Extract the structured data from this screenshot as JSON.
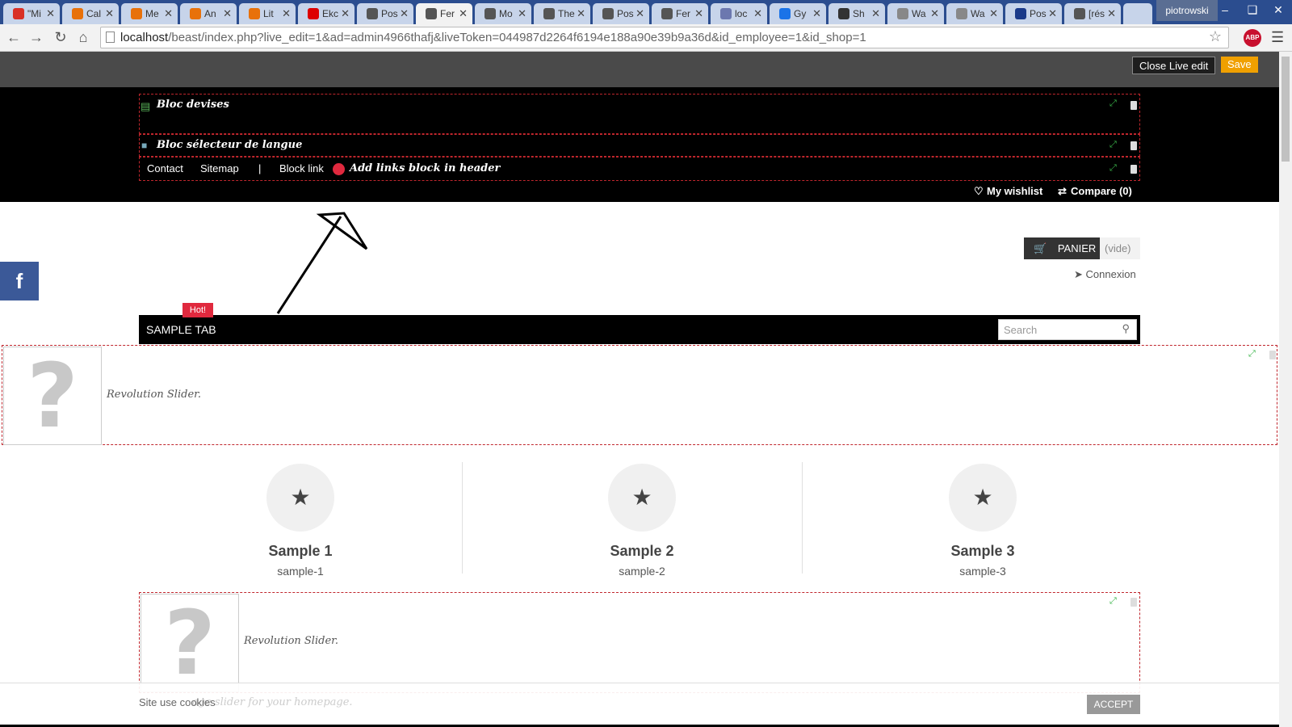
{
  "browser": {
    "tabs": [
      {
        "label": "\"Mi",
        "color": "#d93025"
      },
      {
        "label": "Cal",
        "color": "#e8710a"
      },
      {
        "label": "Me",
        "color": "#e8710a"
      },
      {
        "label": "An",
        "color": "#e8710a"
      },
      {
        "label": "Lit",
        "color": "#e8710a"
      },
      {
        "label": "Ekc",
        "color": "#d00"
      },
      {
        "label": "Pos",
        "color": "#555"
      },
      {
        "label": "Fer",
        "color": "#555"
      },
      {
        "label": "Mo",
        "color": "#555"
      },
      {
        "label": "The",
        "color": "#555"
      },
      {
        "label": "Pos",
        "color": "#555"
      },
      {
        "label": "Fer",
        "color": "#555"
      },
      {
        "label": "loc",
        "color": "#6c78af"
      },
      {
        "label": "Gy",
        "color": "#1a73e8"
      },
      {
        "label": "Sh",
        "color": "#333"
      },
      {
        "label": "Wa",
        "color": "#888"
      },
      {
        "label": "Wa",
        "color": "#888"
      },
      {
        "label": "Pos",
        "color": "#1a3a8a"
      },
      {
        "label": "[rés",
        "color": "#555"
      }
    ],
    "active_tab_index": 7,
    "profile": "piotrowski",
    "url_host": "localhost",
    "url_path": "/beast/index.php?live_edit=1&ad=admin4966thafj&liveToken=044987d2264f6194e188a90e39b9a36d&id_employee=1&id_shop=1",
    "abp_label": "ABP"
  },
  "liveedit": {
    "close_label": "Close Live edit",
    "save_label": "Save"
  },
  "header": {
    "module_currency": "Bloc devises",
    "module_language": "Bloc sélecteur de langue",
    "links": [
      "Contact",
      "Sitemap",
      "|",
      "Block link"
    ],
    "add_links_label": "Add links block in header",
    "wishlist": "My wishlist",
    "compare": "Compare (0)"
  },
  "cart": {
    "label": "PANIER",
    "status": "(vide)"
  },
  "login": "Connexion",
  "menu": {
    "tab": "SAMPLE TAB",
    "hot_badge": "Hot!",
    "search_placeholder": "Search"
  },
  "slider_label": "Revolution Slider.",
  "features": [
    {
      "title": "Sample 1",
      "sub": "sample-1"
    },
    {
      "title": "Sample 2",
      "sub": "sample-2"
    },
    {
      "title": "Sample 3",
      "sub": "sample-3"
    }
  ],
  "cookie": {
    "text": "Site use cookies",
    "ghost_text": "age slider for your homepage.",
    "accept": "ACCEPT"
  },
  "colors": {
    "accent_red": "#c0262d",
    "save_orange": "#f0a000",
    "facebook": "#3b5998",
    "hot_red": "#e0293e"
  }
}
